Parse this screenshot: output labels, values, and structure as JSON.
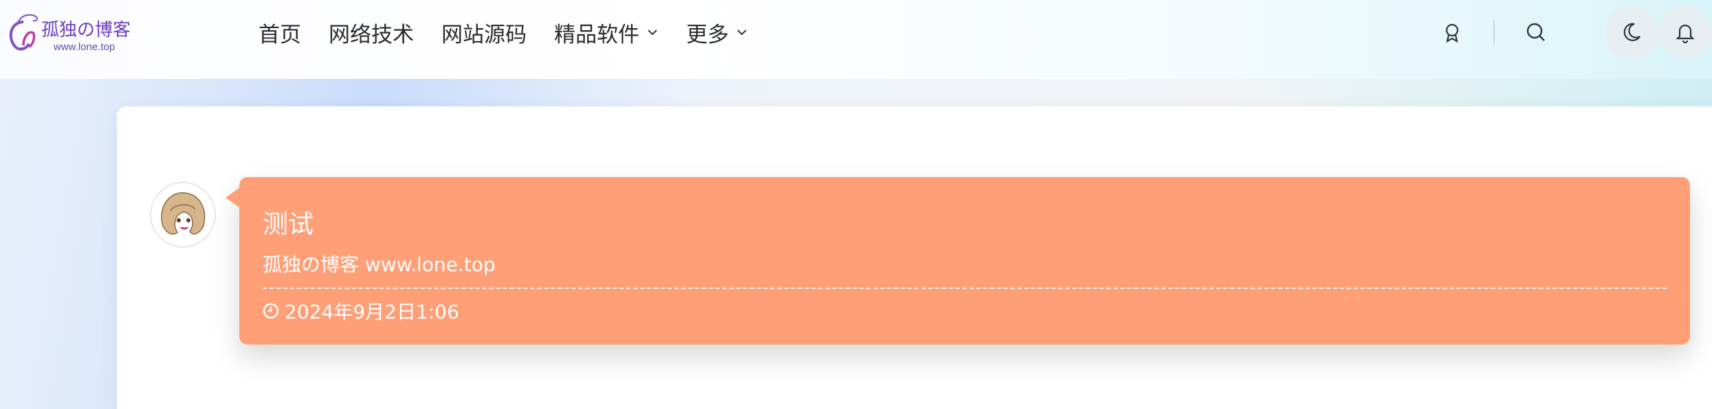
{
  "brand": {
    "logo_text": "孤独の博客",
    "logo_url_text": "www.lone.top"
  },
  "nav": {
    "items": [
      {
        "label": "首页",
        "has_dropdown": false
      },
      {
        "label": "网络技术",
        "has_dropdown": false
      },
      {
        "label": "网站源码",
        "has_dropdown": false
      },
      {
        "label": "精品软件",
        "has_dropdown": true
      },
      {
        "label": "更多",
        "has_dropdown": true
      }
    ]
  },
  "toolbar": {
    "icons": [
      "badge-icon",
      "search-icon",
      "moon-icon",
      "bell-icon"
    ]
  },
  "post": {
    "title": "测试",
    "excerpt": "孤独の博客 www.lone.top",
    "date": "2024年9月2日1:06"
  },
  "colors": {
    "bubble": "#ff9f77",
    "text_dark": "#2b2b2b"
  }
}
